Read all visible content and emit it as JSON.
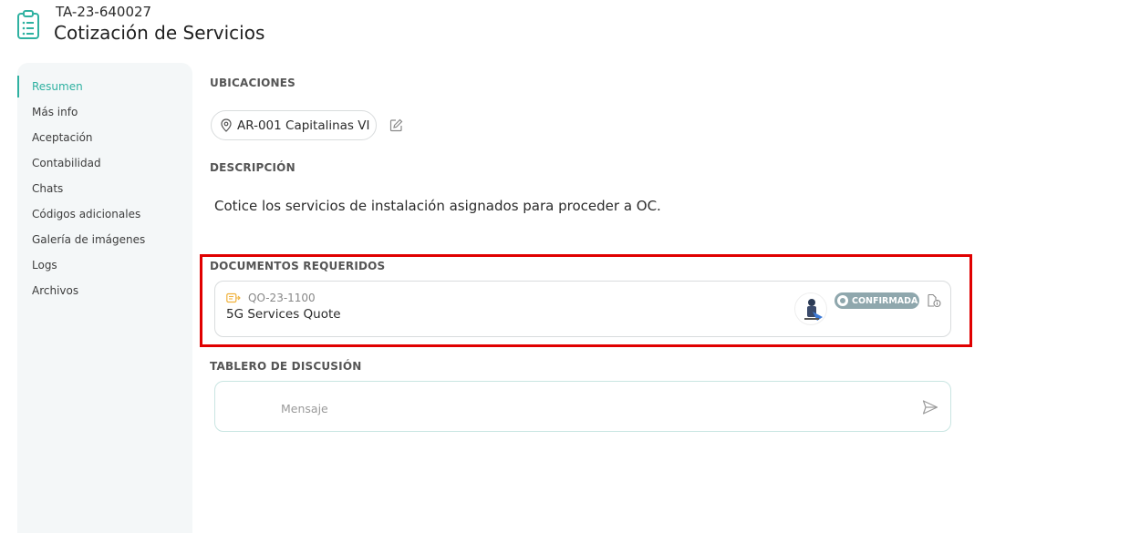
{
  "header": {
    "code": "TA-23-640027",
    "title": "Cotización de Servicios",
    "icon": "clipboard-list-icon"
  },
  "sidebar": {
    "items": [
      {
        "label": "Resumen",
        "active": true
      },
      {
        "label": "Más info"
      },
      {
        "label": "Aceptación"
      },
      {
        "label": "Contabilidad"
      },
      {
        "label": "Chats"
      },
      {
        "label": "Códigos adicionales"
      },
      {
        "label": "Galería de imágenes"
      },
      {
        "label": "Logs"
      },
      {
        "label": "Archivos"
      }
    ]
  },
  "ubicaciones": {
    "title": "UBICACIONES",
    "location_code": "AR-001",
    "location_name": "Capitalinas VI"
  },
  "descripcion": {
    "title": "DESCRIPCIÓN",
    "text": "Cotice los servicios de instalación asignados para proceder a OC."
  },
  "documentos": {
    "title": "DOCUMENTOS REQUERIDOS",
    "items": [
      {
        "code": "QO-23-1100",
        "name": "5G Services Quote",
        "status": "CONFIRMADA"
      }
    ]
  },
  "tablero": {
    "title": "TABLERO DE DISCUSIÓN",
    "placeholder": "Mensaje"
  },
  "colors": {
    "accent": "#2fb1a1",
    "highlight": "#e00000",
    "status_badge": "#8fa7ad",
    "sidebar_bg": "#f4f7f8"
  }
}
